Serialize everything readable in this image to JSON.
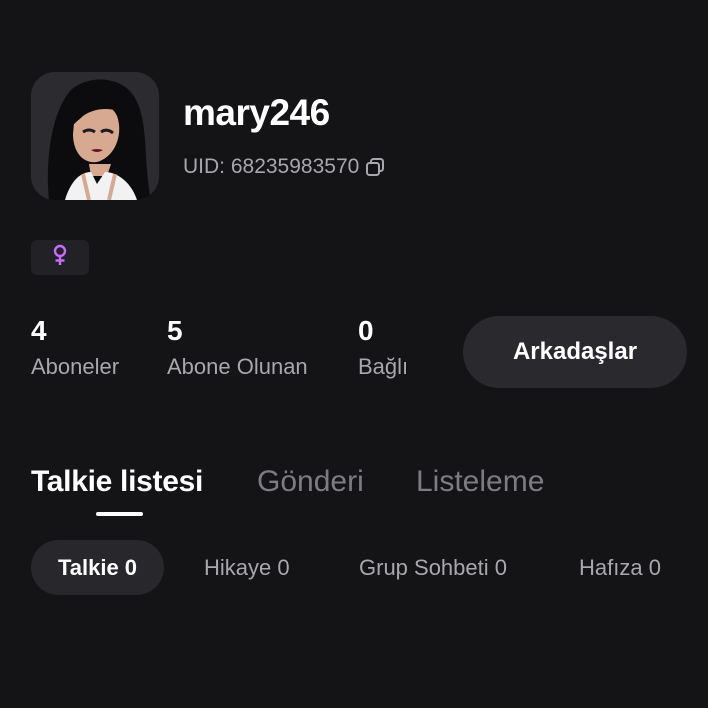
{
  "profile": {
    "username": "mary246",
    "uid_label": "UID: 68235983570",
    "gender_symbol": "♀",
    "gender_color": "#c86cff",
    "avatar_icon": "profile-avatar-image"
  },
  "stats": [
    {
      "value": "4",
      "label": "Aboneler"
    },
    {
      "value": "5",
      "label": "Abone Olunan"
    },
    {
      "value": "0",
      "label": "Bağlı"
    }
  ],
  "friends_button": "Arkadaşlar",
  "tabs": [
    {
      "label": "Talkie listesi",
      "active": true
    },
    {
      "label": "Gönderi",
      "active": false
    },
    {
      "label": "Listeleme",
      "active": false
    }
  ],
  "filters": [
    {
      "label": "Talkie 0",
      "active": true
    },
    {
      "label": "Hikaye 0",
      "active": false
    },
    {
      "label": "Grup Sohbeti 0",
      "active": false
    },
    {
      "label": "Hafıza 0",
      "active": false
    }
  ],
  "colors": {
    "background": "#141416",
    "surface": "#2a2a2e",
    "muted_text": "#a7a7ad",
    "accent_female": "#c86cff"
  }
}
